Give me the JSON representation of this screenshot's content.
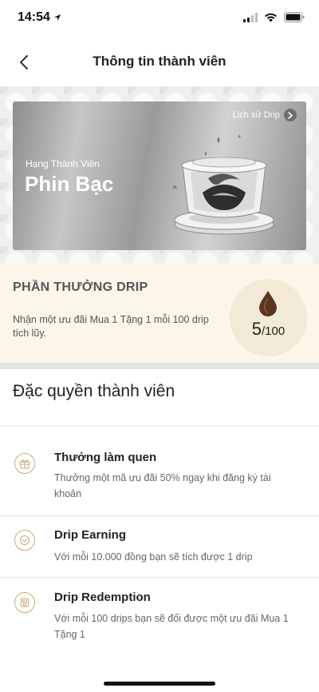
{
  "status_bar": {
    "time": "14:54"
  },
  "header": {
    "title": "Thông tin thành viên",
    "back_icon": "chevron-left-icon"
  },
  "member_card": {
    "history_link": "Lịch sử Drip",
    "tier_label": "Hạng Thành Viên",
    "tier_name": "Phin Bạc"
  },
  "reward": {
    "title": "PHẦN THƯỞNG DRIP",
    "description": "Nhận một ưu đãi Mua 1 Tặng 1 mỗi 100 drip tích lũy.",
    "current": "5",
    "total": "/100"
  },
  "perks": {
    "title": "Đặc quyền thành viên",
    "items": [
      {
        "icon": "gift-icon",
        "title": "Thưởng làm quen",
        "description": "Thưởng một mã ưu đãi 50% ngay khi đăng ký tài khoản"
      },
      {
        "icon": "check-circle-icon",
        "title": "Drip Earning",
        "description": "Với mỗi 10.000 đồng bạn sẽ tích được 1 drip"
      },
      {
        "icon": "coffee-machine-icon",
        "title": "Drip Redemption",
        "description": "Với mỗi 100 drips bạn sẽ đổi được một ưu đãi Mua 1 Tặng 1"
      }
    ]
  },
  "colors": {
    "accent": "#c8a97a",
    "reward_bg": "#fbf6e9",
    "drip": "#5a3520"
  }
}
